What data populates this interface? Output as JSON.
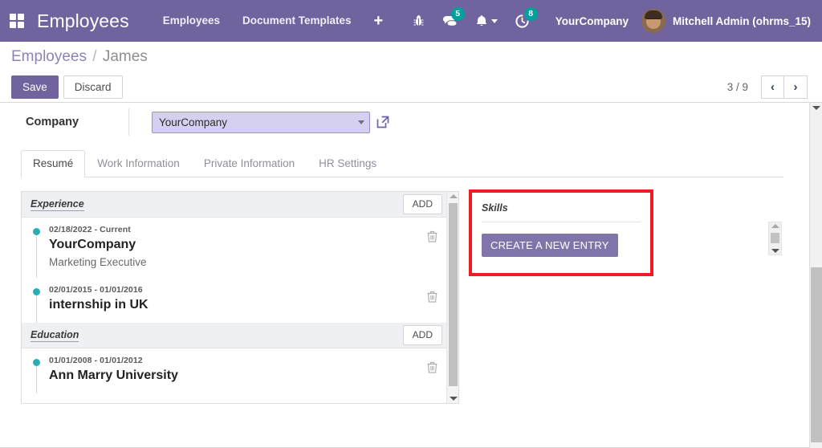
{
  "navbar": {
    "apps_icon": "apps-grid-icon",
    "brand": "Employees",
    "menu_items": [
      {
        "label": "Employees"
      },
      {
        "label": "Document Templates"
      }
    ],
    "new_label": "+",
    "sys_icons": [
      {
        "name": "bug-icon",
        "badge": null
      },
      {
        "name": "messages-icon",
        "badge": "5"
      },
      {
        "name": "activity-bell-icon",
        "badge": null
      },
      {
        "name": "timer-clock-icon",
        "badge": "8"
      }
    ],
    "company": "YourCompany",
    "user": "Mitchell Admin (ohrms_15)",
    "bg_color": "#71639e",
    "badge_color": "#00a09d"
  },
  "control_panel": {
    "breadcrumb_root": "Employees",
    "breadcrumb_sep": "/",
    "breadcrumb_current": "James",
    "save_label": "Save",
    "discard_label": "Discard",
    "pager": "3 / 9",
    "prev_icon": "‹",
    "next_icon": "›"
  },
  "form": {
    "company_field": {
      "label": "Company",
      "value": "YourCompany",
      "ext_link_icon": "external-link-icon",
      "selected": true,
      "highlight_bg": "#d6d0f0"
    },
    "tabs": [
      {
        "label": "Resumé",
        "active": true
      },
      {
        "label": "Work Information",
        "active": false
      },
      {
        "label": "Private Information",
        "active": false
      },
      {
        "label": "HR Settings",
        "active": false
      }
    ]
  },
  "resume": {
    "add_label": "ADD",
    "groups": [
      {
        "title": "Experience",
        "entries": [
          {
            "date": "02/18/2022 - Current",
            "title": "YourCompany",
            "subtitle": "Marketing Executive"
          },
          {
            "date": "02/01/2015 - 01/01/2016",
            "title": "internship in UK",
            "subtitle": ""
          }
        ]
      },
      {
        "title": "Education",
        "entries": [
          {
            "date": "01/01/2008 - 01/01/2012",
            "title": "Ann Marry University",
            "subtitle": ""
          }
        ]
      }
    ],
    "dot_color": "#2aacb8",
    "delete_icon": "trash-icon"
  },
  "skills": {
    "title": "Skills",
    "create_label": "CREATE A NEW ENTRY",
    "button_color": "#8174ab",
    "highlight_color": "#ee1b24"
  }
}
